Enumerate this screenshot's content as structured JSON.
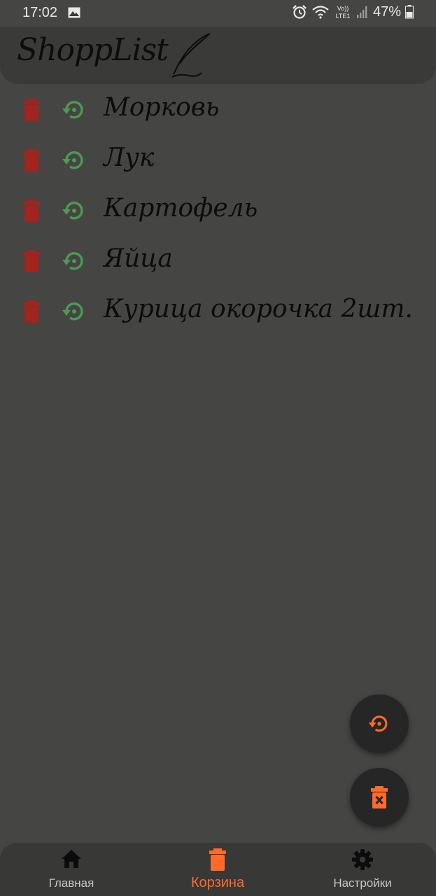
{
  "status_bar": {
    "time": "17:02",
    "battery": "47%",
    "icons": [
      "image-icon",
      "alarm-icon",
      "wifi-icon",
      "volte-icon",
      "signal-icon",
      "battery-icon"
    ],
    "volte_label_top": "Vo))",
    "volte_label_bottom": "LTE1"
  },
  "header": {
    "app_title": "ShoppList"
  },
  "trash_items": [
    {
      "label": "Морковь"
    },
    {
      "label": "Лук"
    },
    {
      "label": "Картофель"
    },
    {
      "label": "Яйца"
    },
    {
      "label": "Курица окорочка 2шт."
    }
  ],
  "fabs": {
    "restore_all": {
      "icon": "restore-icon"
    },
    "delete_all": {
      "icon": "delete-forever-icon"
    }
  },
  "bottom_nav": {
    "items": [
      {
        "label": "Главная",
        "icon": "home-icon",
        "active": false
      },
      {
        "label": "Корзина",
        "icon": "trash-icon",
        "active": true
      },
      {
        "label": "Настройки",
        "icon": "gear-icon",
        "active": false
      }
    ]
  },
  "colors": {
    "background": "#454543",
    "header": "#3a3a38",
    "delete_red": "#a3241e",
    "restore_green": "#4c9a52",
    "accent_orange": "#ff6a2a",
    "fab_background": "#262626"
  }
}
